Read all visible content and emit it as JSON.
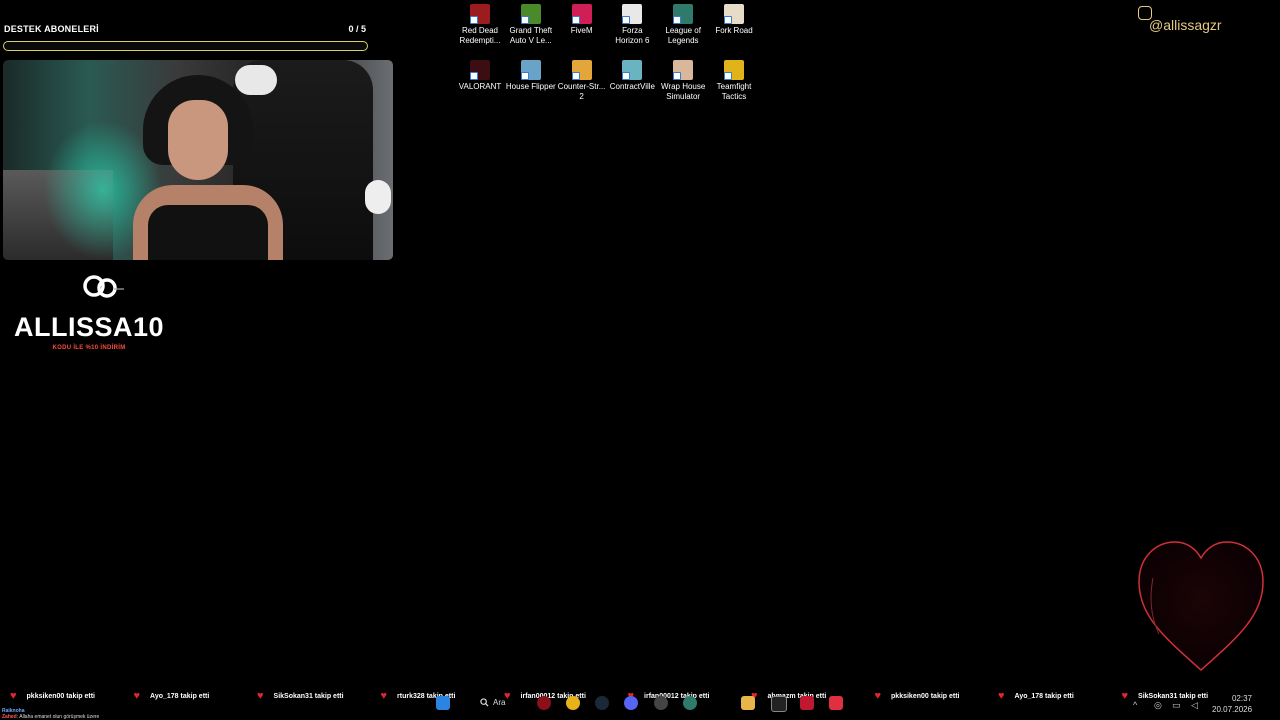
{
  "goal": {
    "title": "DESTEK ABONELERİ",
    "count": "0 / 5",
    "progress": 0.0,
    "bar_color": "#d8cf6a"
  },
  "sponsor": {
    "code": "ALLISSA10",
    "subtitle": "KODU İLE %10 İNDİRİM",
    "accent": "#ff4b3a"
  },
  "social": {
    "instagram": "@allissagzr",
    "color": "#e7c983"
  },
  "desktop_icons": [
    {
      "label": "Red Dead Redempti...",
      "icon": "rdr2-icon",
      "color": "#9b1c1c"
    },
    {
      "label": "Grand Theft Auto V Le...",
      "icon": "gta5-icon",
      "color": "#4a8a2a"
    },
    {
      "label": "FiveM",
      "icon": "fivem-icon",
      "color": "#d01f56"
    },
    {
      "label": "Forza Horizon 6",
      "icon": "forza-icon",
      "color": "#e8e8e8"
    },
    {
      "label": "League of Legends",
      "icon": "lol-icon",
      "color": "#2f7a6a"
    },
    {
      "label": "Fork Road",
      "icon": "forkroad-icon",
      "color": "#e6dcc8"
    },
    {
      "label": "VALORANT",
      "icon": "valorant-icon",
      "color": "#3a0e12"
    },
    {
      "label": "House Flipper",
      "icon": "houseflipper-icon",
      "color": "#6aa3c8"
    },
    {
      "label": "Counter-Str... 2",
      "icon": "cs2-icon",
      "color": "#e3a63a"
    },
    {
      "label": "ContractVille",
      "icon": "contractville-icon",
      "color": "#6ab3c0"
    },
    {
      "label": "Wrap House Simulator",
      "icon": "wraphouse-icon",
      "color": "#d8b79a"
    },
    {
      "label": "Teamfight Tactics",
      "icon": "tft-icon",
      "color": "#e0b318"
    }
  ],
  "ticker": [
    "pkksiken00 takip etti",
    "Ayo_178 takip etti",
    "SikSokan31 takip etti",
    "rturk328 takip etti",
    "irfan00012 takip etti",
    "irfan00012 takip etti",
    "ahmazm takip etti",
    "pkksiken00 takip etti",
    "Ayo_178 takip etti",
    "SikSokan31 takip etti"
  ],
  "taskbar": {
    "search_label": "Ara",
    "time": "02:37",
    "date": "20.07.2026"
  },
  "chat": [
    {
      "user": "Raiknoha",
      "text": ""
    },
    {
      "user": "Zahed",
      "text": "Allaha emanet olun görüşmek üzere"
    }
  ]
}
